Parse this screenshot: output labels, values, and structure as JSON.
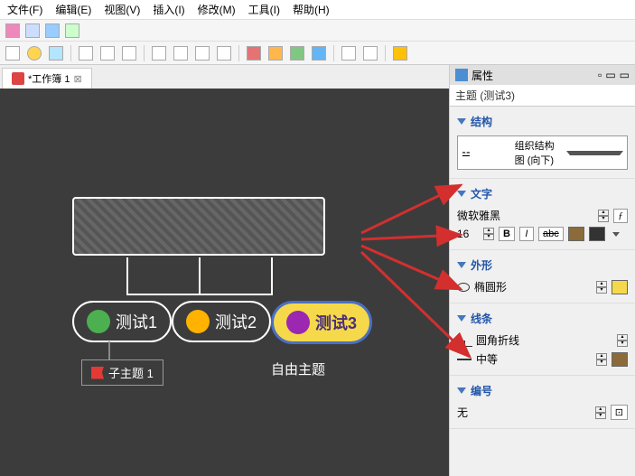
{
  "menu": {
    "file": "文件(F)",
    "edit": "编辑(E)",
    "view": "视图(V)",
    "insert": "插入(I)",
    "modify": "修改(M)",
    "tools": "工具(I)",
    "help": "帮助(H)"
  },
  "tab": {
    "title": "*工作簿 1",
    "close": "×"
  },
  "nodes": {
    "child1": "测试1",
    "child2": "测试2",
    "child3": "测试3",
    "sub": "子主题 1",
    "free": "自由主题"
  },
  "panel": {
    "title": "属性",
    "subject": "主题 (测试3)",
    "sections": {
      "structure": "结构",
      "text": "文字",
      "shape": "外形",
      "line": "线条",
      "number": "编号"
    },
    "structure_sel": "组织结构图 (向下)",
    "font": "微软雅黑",
    "font_size": "16",
    "shape_sel": "椭圆形",
    "line_type": "圆角折线",
    "line_weight": "中等",
    "number_sel": "无",
    "bold": "B",
    "italic": "I",
    "strike": "abc",
    "script_f": "ƒ"
  },
  "colors": {
    "accent": "#2255aa",
    "node3_bg": "#f5d94a",
    "node3_text": "#4a2f7a"
  }
}
